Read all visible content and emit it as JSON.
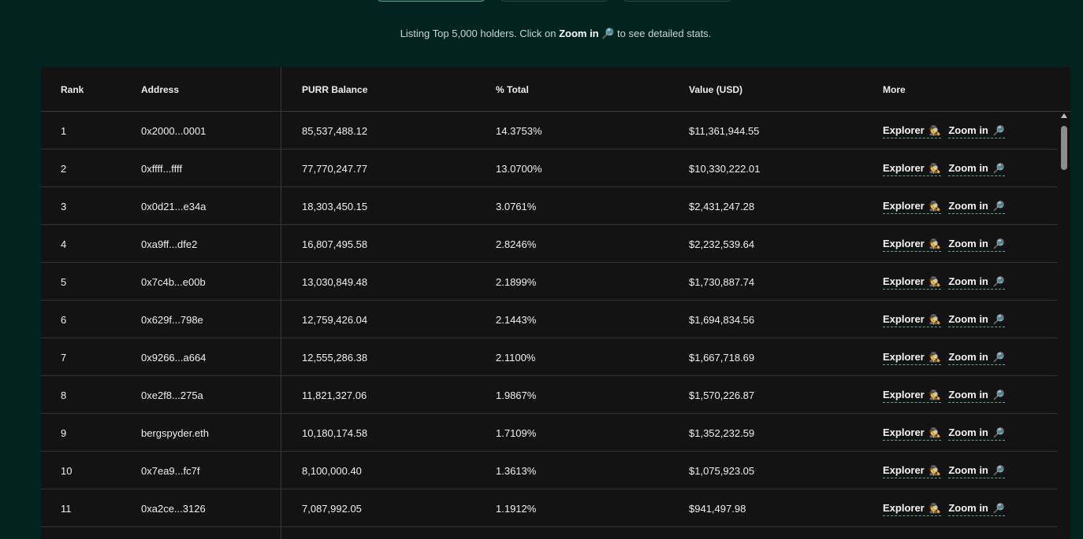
{
  "note": {
    "prefix": "Listing Top 5,000 holders. Click on ",
    "zoom": "Zoom in",
    "icon": "🔎",
    "suffix": " to see detailed stats."
  },
  "table": {
    "headers": {
      "rank": "Rank",
      "address": "Address",
      "balance": "PURR Balance",
      "pct": "% Total",
      "value": "Value (USD)",
      "more": "More"
    },
    "explorer_label": "Explorer",
    "explorer_icon": "🕵️",
    "zoom_label": "Zoom in",
    "zoom_icon": "🔎",
    "rows": [
      {
        "rank": "1",
        "address": "0x2000...0001",
        "balance": "85,537,488.12",
        "pct": "14.3753%",
        "value": "$11,361,944.55"
      },
      {
        "rank": "2",
        "address": "0xffff...ffff",
        "balance": "77,770,247.77",
        "pct": "13.0700%",
        "value": "$10,330,222.01"
      },
      {
        "rank": "3",
        "address": "0x0d21...e34a",
        "balance": "18,303,450.15",
        "pct": "3.0761%",
        "value": "$2,431,247.28"
      },
      {
        "rank": "4",
        "address": "0xa9ff...dfe2",
        "balance": "16,807,495.58",
        "pct": "2.8246%",
        "value": "$2,232,539.64"
      },
      {
        "rank": "5",
        "address": "0x7c4b...e00b",
        "balance": "13,030,849.48",
        "pct": "2.1899%",
        "value": "$1,730,887.74"
      },
      {
        "rank": "6",
        "address": "0x629f...798e",
        "balance": "12,759,426.04",
        "pct": "2.1443%",
        "value": "$1,694,834.56"
      },
      {
        "rank": "7",
        "address": "0x9266...a664",
        "balance": "12,555,286.38",
        "pct": "2.1100%",
        "value": "$1,667,718.69"
      },
      {
        "rank": "8",
        "address": "0xe2f8...275a",
        "balance": "11,821,327.06",
        "pct": "1.9867%",
        "value": "$1,570,226.87"
      },
      {
        "rank": "9",
        "address": "bergspyder.eth",
        "balance": "10,180,174.58",
        "pct": "1.7109%",
        "value": "$1,352,232.59"
      },
      {
        "rank": "10",
        "address": "0x7ea9...fc7f",
        "balance": "8,100,000.40",
        "pct": "1.3613%",
        "value": "$1,075,923.05"
      },
      {
        "rank": "11",
        "address": "0xa2ce...3126",
        "balance": "7,087,992.05",
        "pct": "1.1912%",
        "value": "$941,497.98"
      }
    ]
  }
}
